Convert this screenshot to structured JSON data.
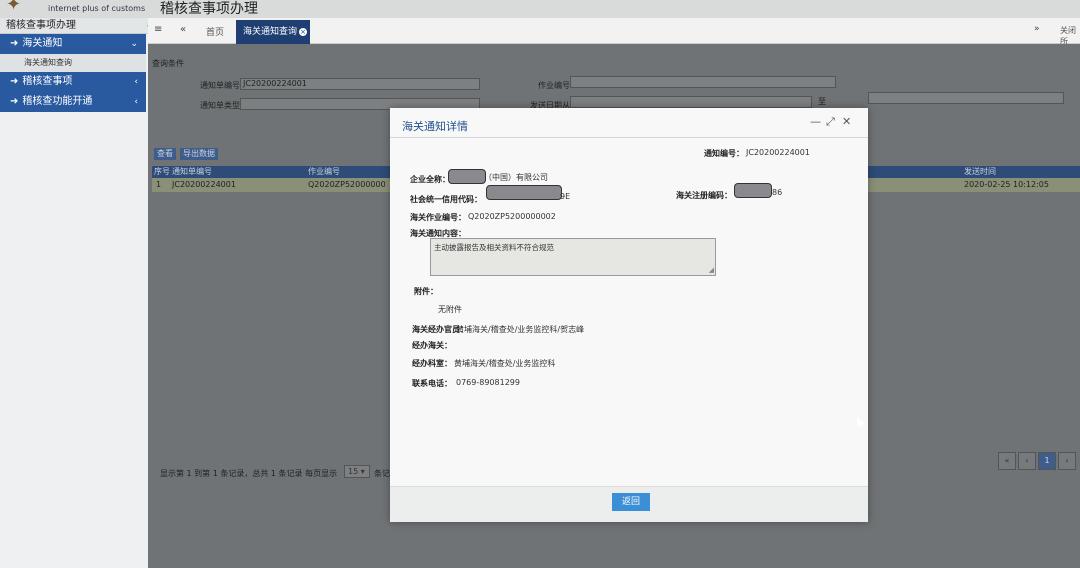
{
  "header": {
    "logo_subtitle": "internet plus of customs",
    "system_title": "稽核查事项办理"
  },
  "sidebar": {
    "title": "稽核查事项办理",
    "items": [
      {
        "label": "海关通知",
        "expanded": true,
        "children": [
          {
            "label": "海关通知查询"
          }
        ]
      },
      {
        "label": "稽核查事项",
        "expanded": false
      },
      {
        "label": "稽核查功能开通",
        "expanded": false
      }
    ]
  },
  "tabs": {
    "home_label": "首页",
    "active_label": "海关通知查询",
    "close_all_label": "关闭所"
  },
  "background": {
    "panel_title": "查询条件",
    "fields": {
      "notice_no_label": "通知单编号",
      "notice_no_value": "JC20200224001",
      "task_no_label": "作业编号",
      "notice_type_label": "通知单类型",
      "send_date_label": "发送日期从",
      "to_label": "至"
    },
    "buttons": [
      "查看",
      "导出数据"
    ],
    "grid": {
      "columns": [
        "序号",
        "通知单编号",
        "作业编号",
        "发送时间"
      ],
      "rows": [
        {
          "index": "1",
          "notice_no": "JC20200224001",
          "task_no": "Q2020ZP52000000",
          "send_time": "2020-02-25 10:12:05"
        }
      ]
    },
    "pager": {
      "summary": "显示第 1 到第 1 条记录，总共 1 条记录 每页显示",
      "page_size": "15",
      "after_size": "条记",
      "current_page": "1"
    }
  },
  "modal": {
    "title": "海关通知详情",
    "notice_no_label": "通知编号：",
    "notice_no": "JC20200224001",
    "company_label": "企业全称：",
    "company_suffix": "（中国）有限公司",
    "credit_label": "社会统一信用代码：",
    "credit_suffix": "9E",
    "reg_label": "海关注册编码：",
    "reg_suffix": "86",
    "task_label": "海关作业编号：",
    "task_no": "Q2020ZP5200000002",
    "content_label": "海关通知内容：",
    "content": "主动披露报告及相关资料不符合规范",
    "attach_label": "附件：",
    "attach_value": "无附件",
    "officer_label": "海关经办官员：",
    "officer_value": "黄埔海关/稽查处/业务监控科/贺志峰",
    "office_label": "经办海关：",
    "dept_label": "经办科室：",
    "dept_value": "黄埔海关/稽查处/业务监控科",
    "phone_label": "联系电话：",
    "phone_value": "0769-89081299",
    "return_label": "返回"
  }
}
